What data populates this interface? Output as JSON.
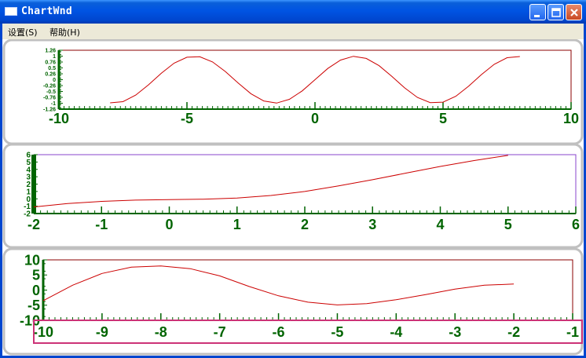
{
  "window": {
    "title": "ChartWnd"
  },
  "menu": {
    "settings": "设置(S)",
    "help": "帮助(H)"
  },
  "colors": {
    "curve": "#cc0000",
    "axis": "#006400",
    "frame1": "#8b0000",
    "frame2": "#8844cc",
    "highlight": "#cc3377",
    "separator": "#c0c0c0"
  },
  "charts": [
    {
      "x_ticks": [
        "-10",
        "-5",
        "0",
        "5",
        "10"
      ],
      "y_ticks": [
        "1.26",
        "1",
        "0.76",
        "0.5",
        "0.26",
        "0",
        "-0.26",
        "-0.5",
        "-0.76",
        "-1",
        "-1.26"
      ]
    },
    {
      "x_ticks": [
        "-2",
        "-1",
        "0",
        "1",
        "2",
        "3",
        "4",
        "5",
        "6"
      ],
      "y_ticks": [
        "6",
        "5",
        "4",
        "3",
        "2",
        "1",
        "0",
        "-1",
        "-2"
      ]
    },
    {
      "x_ticks": [
        "-10",
        "-9",
        "-8",
        "-7",
        "-6",
        "-5",
        "-4",
        "-3",
        "-2",
        "-1"
      ],
      "y_ticks": [
        "10",
        "5",
        "0",
        "-5",
        "-10"
      ]
    }
  ],
  "chart_data": [
    {
      "type": "line",
      "xlim": [
        -10,
        10
      ],
      "ylim": [
        -1.26,
        1.26
      ],
      "series": [
        {
          "x": [
            -8,
            -7.5,
            -7,
            -6.5,
            -6,
            -5.5,
            -5,
            -4.5,
            -4,
            -3.5,
            -3,
            -2.5,
            -2,
            -1.5,
            -1,
            -0.5,
            0,
            0.5,
            1,
            1.5,
            2,
            2.5,
            3,
            3.5,
            4,
            4.5,
            5,
            5.5,
            6,
            6.5,
            7,
            7.5,
            8
          ],
          "y": [
            -0.99,
            -0.94,
            -0.66,
            -0.22,
            0.28,
            0.71,
            0.96,
            0.98,
            0.76,
            0.35,
            -0.14,
            -0.6,
            -0.91,
            -1.0,
            -0.84,
            -0.48,
            0.0,
            0.48,
            0.84,
            1.0,
            0.91,
            0.6,
            0.14,
            -0.35,
            -0.76,
            -0.98,
            -0.96,
            -0.71,
            -0.28,
            0.22,
            0.66,
            0.94,
            0.99
          ]
        }
      ]
    },
    {
      "type": "line",
      "xlim": [
        -2,
        6
      ],
      "ylim": [
        -2,
        6
      ],
      "series": [
        {
          "x": [
            -2,
            -1.5,
            -1,
            -0.5,
            0,
            0.5,
            1,
            1.5,
            2,
            2.5,
            3,
            3.5,
            4,
            4.5,
            5
          ],
          "y": [
            -1.1,
            -0.65,
            -0.35,
            -0.18,
            -0.1,
            -0.05,
            0.1,
            0.45,
            1.0,
            1.75,
            2.6,
            3.5,
            4.4,
            5.2,
            5.9
          ]
        }
      ]
    },
    {
      "type": "line",
      "xlim": [
        -10,
        -1
      ],
      "ylim": [
        -10,
        10
      ],
      "series": [
        {
          "x": [
            -10,
            -9.5,
            -9,
            -8.5,
            -8,
            -7.5,
            -7,
            -6.5,
            -6,
            -5.5,
            -5,
            -4.5,
            -4,
            -3.5,
            -3,
            -2.5,
            -2
          ],
          "y": [
            -3.5,
            1.6,
            5.5,
            7.6,
            8.0,
            7.1,
            4.7,
            1.2,
            -1.9,
            -4.0,
            -4.9,
            -4.5,
            -3.2,
            -1.5,
            0.3,
            1.6,
            2.0
          ]
        }
      ]
    }
  ]
}
